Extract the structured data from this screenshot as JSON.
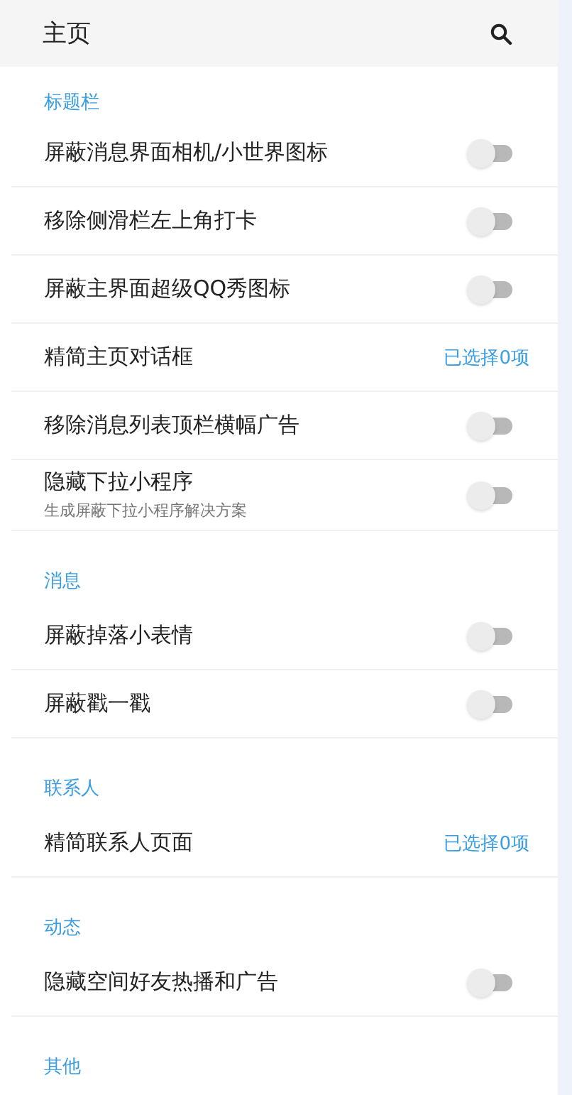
{
  "header": {
    "title": "主页"
  },
  "sections": [
    {
      "title": "标题栏",
      "items": [
        {
          "kind": "toggle",
          "label": "屏蔽消息界面相机/小世界图标",
          "on": false
        },
        {
          "kind": "toggle",
          "label": "移除侧滑栏左上角打卡",
          "on": false
        },
        {
          "kind": "toggle",
          "label": "屏蔽主界面超级QQ秀图标",
          "on": false
        },
        {
          "kind": "select",
          "label": "精简主页对话框",
          "value": "已选择0项"
        },
        {
          "kind": "toggle",
          "label": "移除消息列表顶栏横幅广告",
          "on": false
        },
        {
          "kind": "toggle",
          "label": "隐藏下拉小程序",
          "subtitle": "生成屏蔽下拉小程序解决方案",
          "on": false
        }
      ]
    },
    {
      "title": "消息",
      "items": [
        {
          "kind": "toggle",
          "label": "屏蔽掉落小表情",
          "on": false
        },
        {
          "kind": "toggle",
          "label": "屏蔽戳一戳",
          "on": false
        }
      ]
    },
    {
      "title": "联系人",
      "items": [
        {
          "kind": "select",
          "label": "精简联系人页面",
          "value": "已选择0项"
        }
      ]
    },
    {
      "title": "动态",
      "items": [
        {
          "kind": "toggle",
          "label": "隐藏空间好友热播和广告",
          "on": false
        }
      ]
    },
    {
      "title": "其他"
    }
  ]
}
